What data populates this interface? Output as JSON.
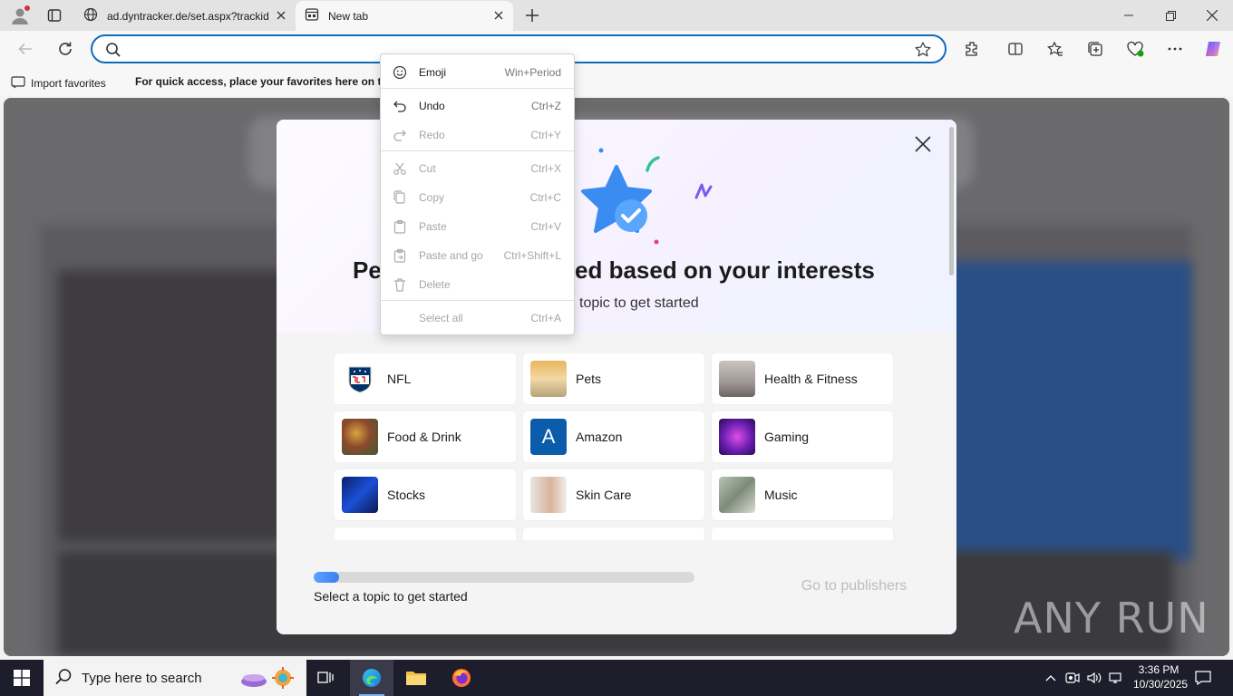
{
  "browser": {
    "tabs": [
      {
        "label": "ad.dyntracker.de/set.aspx?trackid"
      },
      {
        "label": "New tab"
      }
    ],
    "address": {
      "value": "",
      "placeholder": ""
    }
  },
  "favorites_bar": {
    "import_label": "Import favorites",
    "hint": "For quick access, place your favorites here on the favorites bar."
  },
  "context_menu": {
    "items": [
      {
        "label": "Emoji",
        "shortcut": "Win+Period",
        "icon": "emoji-icon",
        "enabled": true
      },
      {
        "label": "Undo",
        "shortcut": "Ctrl+Z",
        "icon": "undo-icon",
        "enabled": true
      },
      {
        "label": "Redo",
        "shortcut": "Ctrl+Y",
        "icon": "redo-icon",
        "enabled": false
      },
      {
        "label": "Cut",
        "shortcut": "Ctrl+X",
        "icon": "cut-icon",
        "enabled": false
      },
      {
        "label": "Copy",
        "shortcut": "Ctrl+C",
        "icon": "copy-icon",
        "enabled": false
      },
      {
        "label": "Paste",
        "shortcut": "Ctrl+V",
        "icon": "paste-icon",
        "enabled": false
      },
      {
        "label": "Paste and go",
        "shortcut": "Ctrl+Shift+L",
        "icon": "paste-go-icon",
        "enabled": false
      },
      {
        "label": "Delete",
        "shortcut": "",
        "icon": "delete-icon",
        "enabled": false
      },
      {
        "label": "Select all",
        "shortcut": "Ctrl+A",
        "icon": "",
        "enabled": false
      }
    ]
  },
  "modal": {
    "heading_left": "Pe",
    "heading_right": "ed based on your interests",
    "subtitle": "topic to get started",
    "topics": [
      {
        "label": "NFL",
        "thumb": "nfl-logo"
      },
      {
        "label": "Pets",
        "thumb": "pets-photo"
      },
      {
        "label": "Health & Fitness",
        "thumb": "fitness-photo"
      },
      {
        "label": "Food & Drink",
        "thumb": "food-photo"
      },
      {
        "label": "Amazon",
        "thumb": "amazon-letter-a"
      },
      {
        "label": "Gaming",
        "thumb": "gaming-photo"
      },
      {
        "label": "Stocks",
        "thumb": "stocks-photo"
      },
      {
        "label": "Skin Care",
        "thumb": "skincare-photo"
      },
      {
        "label": "Music",
        "thumb": "music-photo"
      }
    ],
    "amazon_letter": "A",
    "progress_fraction": 0.067,
    "progress_text": "Select a topic to get started",
    "go_button": "Go to publishers"
  },
  "watermark": "ANY RUN",
  "taskbar": {
    "search_placeholder": "Type here to search",
    "time": "3:36 PM",
    "date": "10/30/2025"
  },
  "colors": {
    "accent": "#0f6cbd",
    "taskbar": "#1d1d2b",
    "star": "#3b8cf0"
  }
}
